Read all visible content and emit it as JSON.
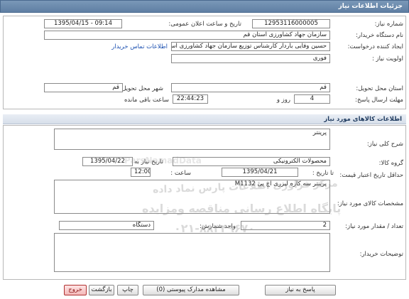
{
  "window": {
    "title": "جزئیات اطلاعات نیاز"
  },
  "general": {
    "need_number_label": "شماره نیاز:",
    "need_number": "12953116000005",
    "announce_label": "تاریخ و ساعت اعلان عمومی:",
    "announce_value": "1395/04/15 - 09:14",
    "buyer_org_label": "نام دستگاه خریدار:",
    "buyer_org": "سازمان جهاد کشاورزی استان قم",
    "creator_label": "ایجاد کننده درخواست:",
    "creator": "حسین وفایی باردار کارشناس توزیع سازمان جهاد کشاورزی استان قم",
    "contact_link": "اطلاعات تماس خریدار",
    "priority_label": "اولویت نیاز :",
    "priority": "فوری",
    "province_label": "استان محل تحویل:",
    "province": "قم",
    "city_label": "شهر محل تحویل:",
    "city": "قم",
    "deadline_label": "مهلت ارسال پاسخ:",
    "deadline_days": "4",
    "deadline_days_unit": "روز و",
    "deadline_time": "22:44:23",
    "deadline_time_unit": "ساعت باقی مانده"
  },
  "goods": {
    "section_title": "اطلاعات کالاهای مورد نیاز",
    "summary_label": "شرح کلی نیاز:",
    "summary": "پرینتر",
    "group_label": "گروه کالا:",
    "group": "محصولات الکترونیکی",
    "need_date_label": "تاریخ نیاز به کالا:",
    "need_date": "1395/04/22",
    "min_price_label": "حداقل تاریخ اعتبار قیمت:",
    "until_date_label": "تا تاریخ :",
    "until_date": "1395/04/21",
    "time_label": "ساعت :",
    "time_value": "12:00",
    "spec_label": "مشخصات کالای مورد نیاز:",
    "spec": "پرینتر سه کاره لیزری اچ پی M1132",
    "qty_label": "تعداد / مقدار مورد نیاز:",
    "qty": "2",
    "unit_label": "واحد شمارش:",
    "unit": "دستگاه",
    "buyer_notes_label": "توضیحات خریدار:",
    "buyer_notes": ""
  },
  "watermark": {
    "line1": "مرکز فراوری اطلاعات پارس نماد داده",
    "line2": "پایگاه اطلاع رسانی مناقصه ومزایده",
    "line3": "۰۲۱-۸۸۳۴۹۶۷۰",
    "brand": "ParsNamadData"
  },
  "buttons": {
    "reply": "پاسخ به نیاز",
    "attachments": "مشاهده مدارک پیوستی (0)",
    "print": "چاپ",
    "back": "بازگشت",
    "exit": "خروج"
  }
}
